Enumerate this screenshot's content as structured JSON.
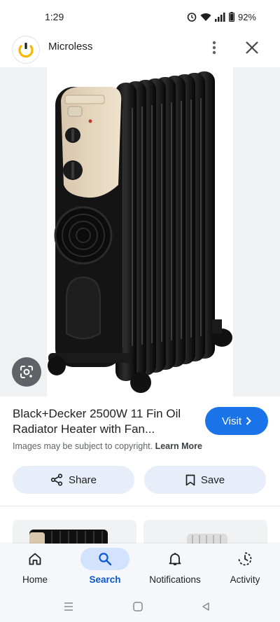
{
  "status_bar": {
    "time": "1:29",
    "battery": "92%"
  },
  "header": {
    "site_name": "Microless",
    "logo_icon": "microless-logo-icon",
    "more_icon": "more-vert-icon",
    "close_icon": "close-icon"
  },
  "image": {
    "lens_icon": "google-lens-icon"
  },
  "result": {
    "title": "Black+Decker 2500W 11 Fin Oil Radiator Heater with Fan...",
    "visit_label": "Visit",
    "copyright_text": "Images may be subject to copyright.",
    "learn_more": "Learn More"
  },
  "actions": {
    "share_label": "Share",
    "save_label": "Save"
  },
  "bottom_nav": {
    "items": [
      {
        "label": "Home",
        "icon": "home-icon"
      },
      {
        "label": "Search",
        "icon": "search-icon"
      },
      {
        "label": "Notifications",
        "icon": "bell-icon"
      },
      {
        "label": "Activity",
        "icon": "activity-icon"
      }
    ],
    "active": "Search"
  },
  "colors": {
    "accent": "#1a73e8",
    "active_nav_bg": "#d3e3fd",
    "action_bg": "#e8eef9",
    "logo_yellow": "#f5b800"
  }
}
